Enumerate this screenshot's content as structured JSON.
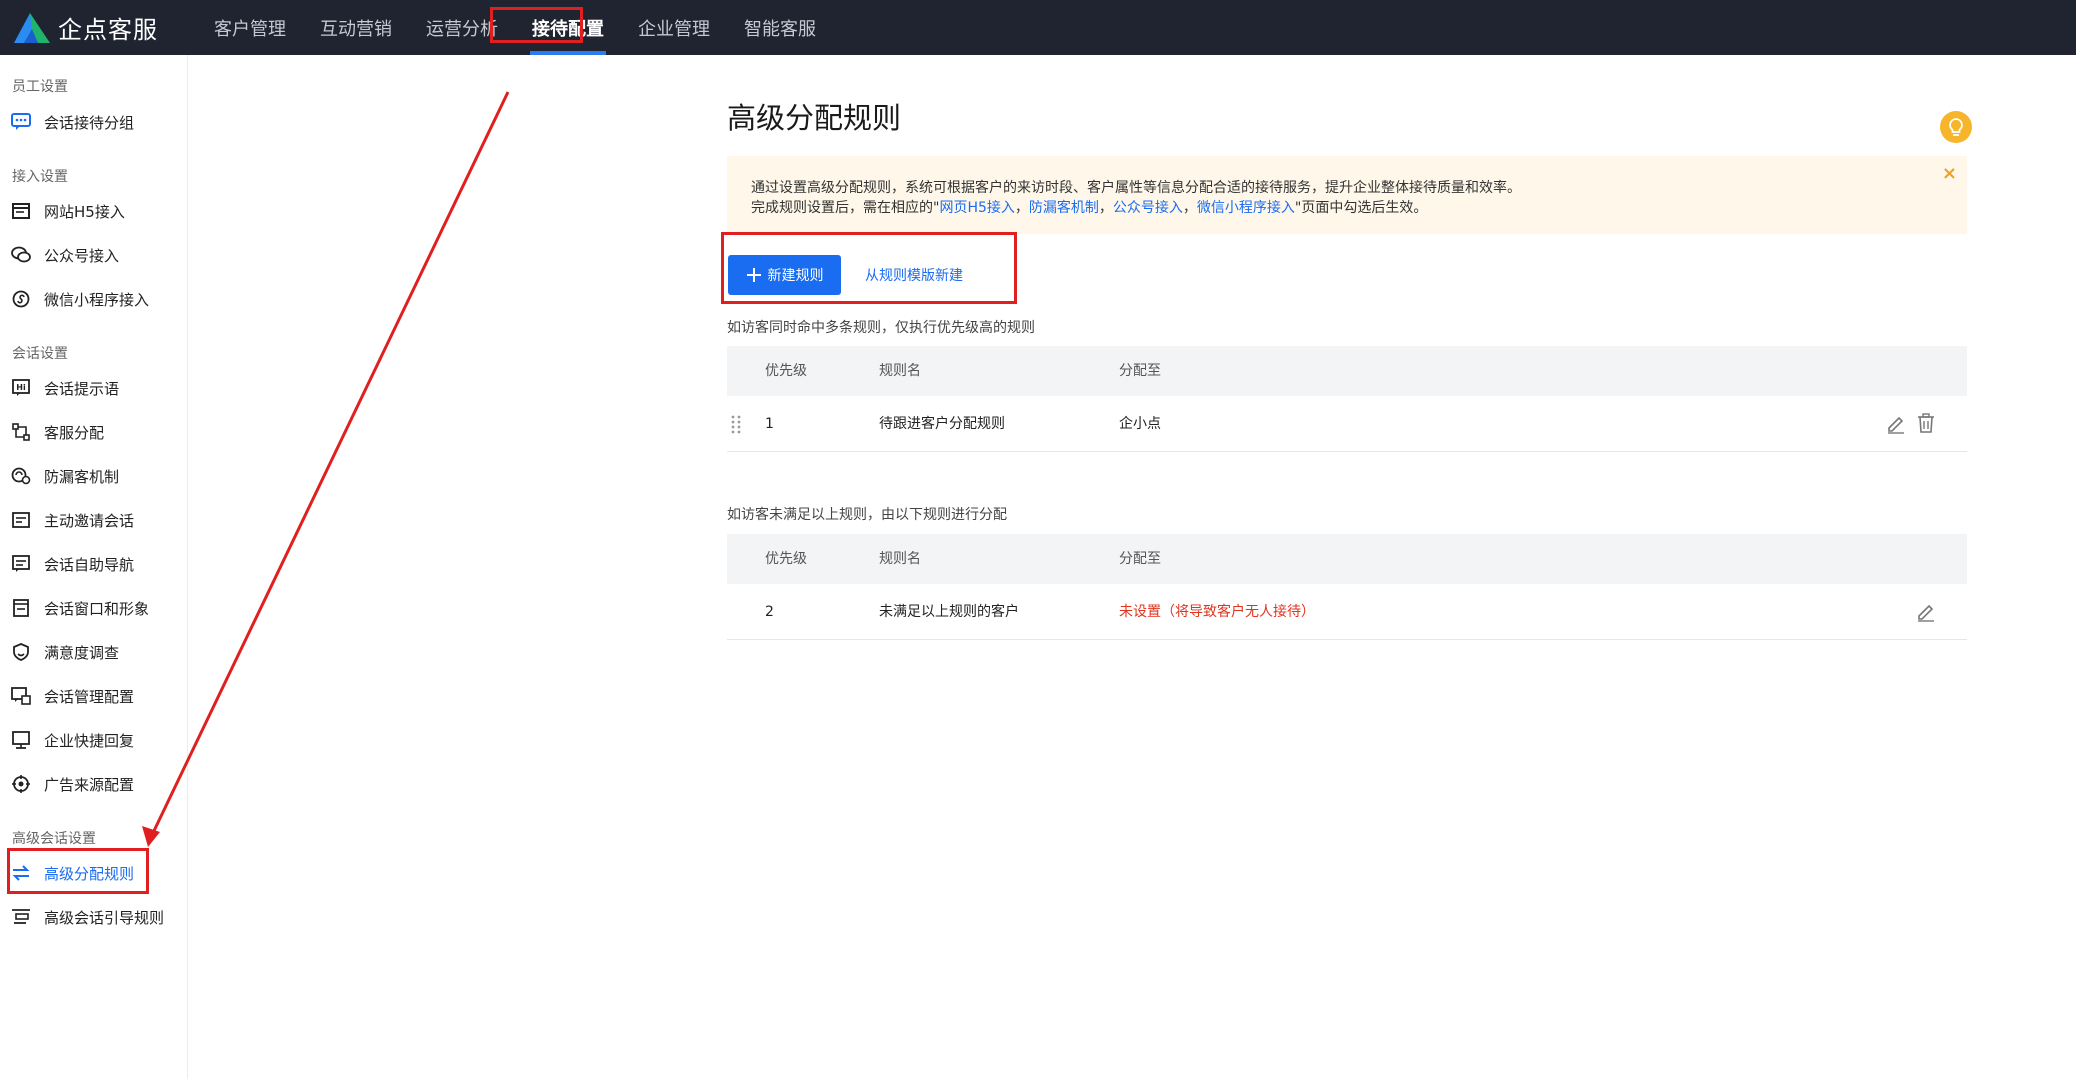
{
  "brand": {
    "name": "企点客服"
  },
  "nav": {
    "items": [
      {
        "label": "客户管理"
      },
      {
        "label": "互动营销"
      },
      {
        "label": "运营分析"
      },
      {
        "label": "接待配置"
      },
      {
        "label": "企业管理"
      },
      {
        "label": "智能客服"
      }
    ],
    "active": "接待配置"
  },
  "sidebar": {
    "groups": [
      {
        "title": "员工设置"
      },
      {
        "title": "接入设置"
      },
      {
        "title": "会话设置"
      },
      {
        "title": "高级会话设置"
      }
    ],
    "items": [
      {
        "label": "会话接待分组",
        "icon": "chat-group-icon"
      },
      {
        "label": "网站H5接入",
        "icon": "web-icon"
      },
      {
        "label": "公众号接入",
        "icon": "wechat-icon"
      },
      {
        "label": "微信小程序接入",
        "icon": "miniprogram-icon"
      },
      {
        "label": "会话提示语",
        "icon": "hi-icon"
      },
      {
        "label": "客服分配",
        "icon": "route-icon"
      },
      {
        "label": "防漏客机制",
        "icon": "guard-icon"
      },
      {
        "label": "主动邀请会话",
        "icon": "invite-icon"
      },
      {
        "label": "会话自助导航",
        "icon": "nav-icon"
      },
      {
        "label": "会话窗口和形象",
        "icon": "window-icon"
      },
      {
        "label": "满意度调查",
        "icon": "badge-icon"
      },
      {
        "label": "会话管理配置",
        "icon": "manage-icon"
      },
      {
        "label": "企业快捷回复",
        "icon": "reply-icon"
      },
      {
        "label": "广告来源配置",
        "icon": "target-icon"
      },
      {
        "label": "高级分配规则",
        "icon": "swap-icon"
      },
      {
        "label": "高级会话引导规则",
        "icon": "guide-icon"
      }
    ],
    "active": "高级分配规则"
  },
  "main": {
    "title": "高级分配规则",
    "notice": {
      "line1": "通过设置高级分配规则，系统可根据客户的来访时段、客户属性等信息分配合适的接待服务，提升企业整体接待质量和效率。",
      "line2_prefix": "完成规则设置后，需在相应的\"",
      "links": [
        "网页H5接入",
        "防漏客机制",
        "公众号接入",
        "微信小程序接入"
      ],
      "separator": "，",
      "line2_suffix": "\"页面中勾选后生效。",
      "close": "×"
    },
    "new_rule_button": "新建规则",
    "template_link": "从规则模版新建",
    "tip1": "如访客同时命中多条规则，仅执行优先级高的规则",
    "tip2": "如访客未满足以上规则，由以下规则进行分配",
    "columns": [
      "优先级",
      "规则名",
      "分配至"
    ],
    "table1": [
      {
        "priority": "1",
        "name": "待跟进客户分配规则",
        "target": "企小点"
      }
    ],
    "table2": [
      {
        "priority": "2",
        "name": "未满足以上规则的客户",
        "target": "未设置（将导致客户无人接待）"
      }
    ]
  },
  "colors": {
    "primary": "#1a6cf0",
    "topbar": "#1f2430",
    "warning_red": "#e0341f",
    "highlight": "#e02020",
    "notice_bg": "#fff8ea"
  }
}
